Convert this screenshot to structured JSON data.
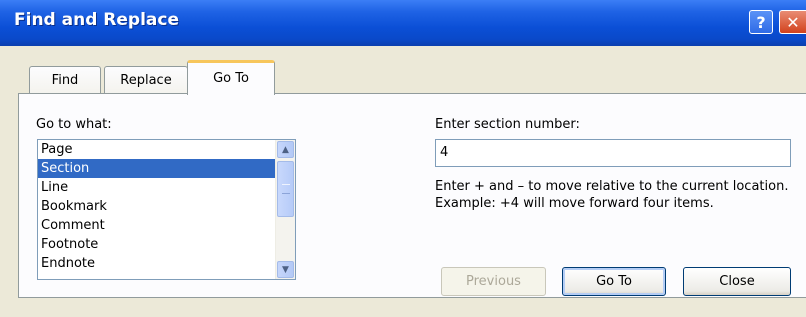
{
  "window": {
    "title": "Find and Replace",
    "help_glyph": "?",
    "close_glyph": "✕"
  },
  "tabs": [
    {
      "label": "Find"
    },
    {
      "label": "Replace"
    },
    {
      "label": "Go To"
    }
  ],
  "goto_what": {
    "label": "Go to what:",
    "items": [
      "Page",
      "Section",
      "Line",
      "Bookmark",
      "Comment",
      "Footnote",
      "Endnote"
    ],
    "selected": "Section"
  },
  "section_number": {
    "label": "Enter section number:",
    "value": "4",
    "help": "Enter + and – to move relative to the current location. Example: +4 will move forward four items."
  },
  "buttons": {
    "previous": "Previous",
    "goto": "Go To",
    "close": "Close"
  },
  "icons": {
    "scroll_up": "▲",
    "scroll_down": "▼"
  },
  "colors": {
    "titlebar": "#0b4fd6",
    "selection": "#316ac5",
    "active_tab_highlight": "#f7c65c"
  }
}
